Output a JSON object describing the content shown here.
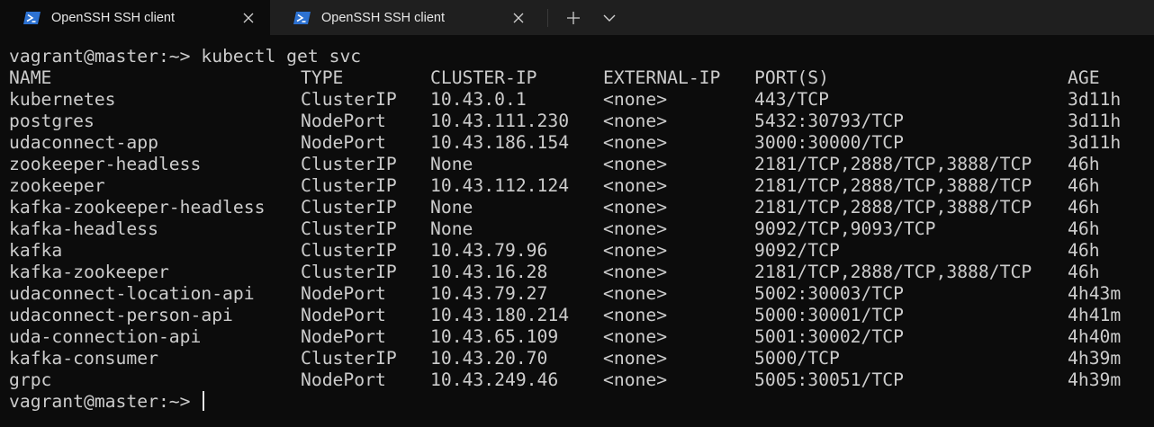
{
  "tabs": [
    {
      "title": "OpenSSH SSH client",
      "active": true,
      "icon": "powershell-icon"
    },
    {
      "title": "OpenSSH SSH client",
      "active": false,
      "icon": "powershell-icon"
    }
  ],
  "toolbar": {
    "new_tab_icon": "plus-icon",
    "dropdown_icon": "chevron-down-icon",
    "close_icon": "close-icon"
  },
  "terminal": {
    "prompt": "vagrant@master:~> ",
    "command": "kubectl get svc",
    "headers": [
      "NAME",
      "TYPE",
      "CLUSTER-IP",
      "EXTERNAL-IP",
      "PORT(S)",
      "AGE"
    ],
    "rows": [
      [
        "kubernetes",
        "ClusterIP",
        "10.43.0.1",
        "<none>",
        "443/TCP",
        "3d11h"
      ],
      [
        "postgres",
        "NodePort",
        "10.43.111.230",
        "<none>",
        "5432:30793/TCP",
        "3d11h"
      ],
      [
        "udaconnect-app",
        "NodePort",
        "10.43.186.154",
        "<none>",
        "3000:30000/TCP",
        "3d11h"
      ],
      [
        "zookeeper-headless",
        "ClusterIP",
        "None",
        "<none>",
        "2181/TCP,2888/TCP,3888/TCP",
        "46h"
      ],
      [
        "zookeeper",
        "ClusterIP",
        "10.43.112.124",
        "<none>",
        "2181/TCP,2888/TCP,3888/TCP",
        "46h"
      ],
      [
        "kafka-zookeeper-headless",
        "ClusterIP",
        "None",
        "<none>",
        "2181/TCP,2888/TCP,3888/TCP",
        "46h"
      ],
      [
        "kafka-headless",
        "ClusterIP",
        "None",
        "<none>",
        "9092/TCP,9093/TCP",
        "46h"
      ],
      [
        "kafka",
        "ClusterIP",
        "10.43.79.96",
        "<none>",
        "9092/TCP",
        "46h"
      ],
      [
        "kafka-zookeeper",
        "ClusterIP",
        "10.43.16.28",
        "<none>",
        "2181/TCP,2888/TCP,3888/TCP",
        "46h"
      ],
      [
        "udaconnect-location-api",
        "NodePort",
        "10.43.79.27",
        "<none>",
        "5002:30003/TCP",
        "4h43m"
      ],
      [
        "udaconnect-person-api",
        "NodePort",
        "10.43.180.214",
        "<none>",
        "5000:30001/TCP",
        "4h41m"
      ],
      [
        "uda-connection-api",
        "NodePort",
        "10.43.65.109",
        "<none>",
        "5001:30002/TCP",
        "4h40m"
      ],
      [
        "kafka-consumer",
        "ClusterIP",
        "10.43.20.70",
        "<none>",
        "5000/TCP",
        "4h39m"
      ],
      [
        "grpc",
        "NodePort",
        "10.43.249.46",
        "<none>",
        "5005:30051/TCP",
        "4h39m"
      ]
    ],
    "final_prompt": "vagrant@master:~> "
  }
}
